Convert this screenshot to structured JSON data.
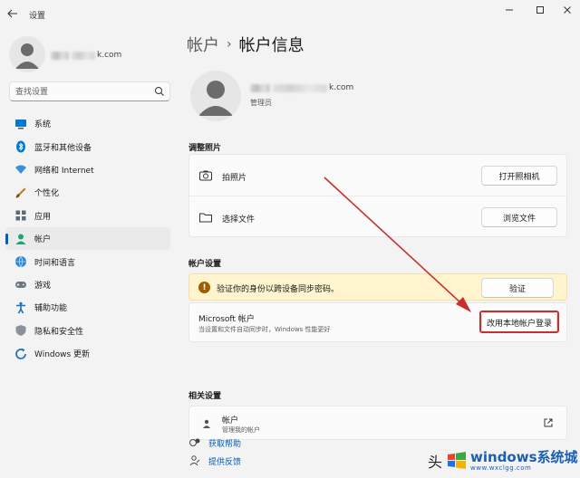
{
  "window": {
    "title": "设置"
  },
  "sidebar": {
    "user_email_tail": "k.com",
    "search_placeholder": "查找设置",
    "items": [
      {
        "label": "系统",
        "icon": "monitor-icon"
      },
      {
        "label": "蓝牙和其他设备",
        "icon": "bluetooth-icon"
      },
      {
        "label": "网络和 Internet",
        "icon": "wifi-icon"
      },
      {
        "label": "个性化",
        "icon": "brush-icon"
      },
      {
        "label": "应用",
        "icon": "apps-icon"
      },
      {
        "label": "帐户",
        "icon": "person-icon",
        "active": true
      },
      {
        "label": "时间和语言",
        "icon": "globe-clock-icon"
      },
      {
        "label": "游戏",
        "icon": "gamepad-icon"
      },
      {
        "label": "辅助功能",
        "icon": "accessibility-icon"
      },
      {
        "label": "隐私和安全性",
        "icon": "shield-icon"
      },
      {
        "label": "Windows 更新",
        "icon": "update-icon"
      }
    ]
  },
  "main": {
    "breadcrumb": {
      "parent": "帐户",
      "separator": "›",
      "current": "帐户信息"
    },
    "profile": {
      "email_tail": "k.com",
      "role": "管理员"
    },
    "photo_section": {
      "title": "调整照片",
      "rows": [
        {
          "label": "拍照片",
          "button": "打开照相机",
          "icon": "camera-icon"
        },
        {
          "label": "选择文件",
          "button": "浏览文件",
          "icon": "folder-icon"
        }
      ]
    },
    "account_section": {
      "title": "帐户设置",
      "warning": {
        "text": "验证你的身份以跨设备同步密码。",
        "button": "验证"
      },
      "microsoft": {
        "title": "Microsoft 帐户",
        "desc": "当设置和文件自动同步时，Windows 性能更好",
        "button": "改用本地帐户登录"
      }
    },
    "related_section": {
      "title": "相关设置",
      "item": {
        "title": "帐户",
        "desc": "管理我的帐户"
      }
    },
    "help_links": [
      {
        "label": "获取帮助",
        "icon": "help-icon"
      },
      {
        "label": "提供反馈",
        "icon": "feedback-icon"
      }
    ]
  },
  "annotation": {
    "arrow_color": "#c8302b",
    "highlight_color": "#c8302b"
  },
  "watermark": {
    "prefix": "头",
    "main": "windows系统城",
    "sub": "www.wxclgg.com"
  },
  "colors": {
    "accent": "#005fb8",
    "warning_bg": "#fff4ce",
    "warning_icon": "#9d5d00"
  }
}
